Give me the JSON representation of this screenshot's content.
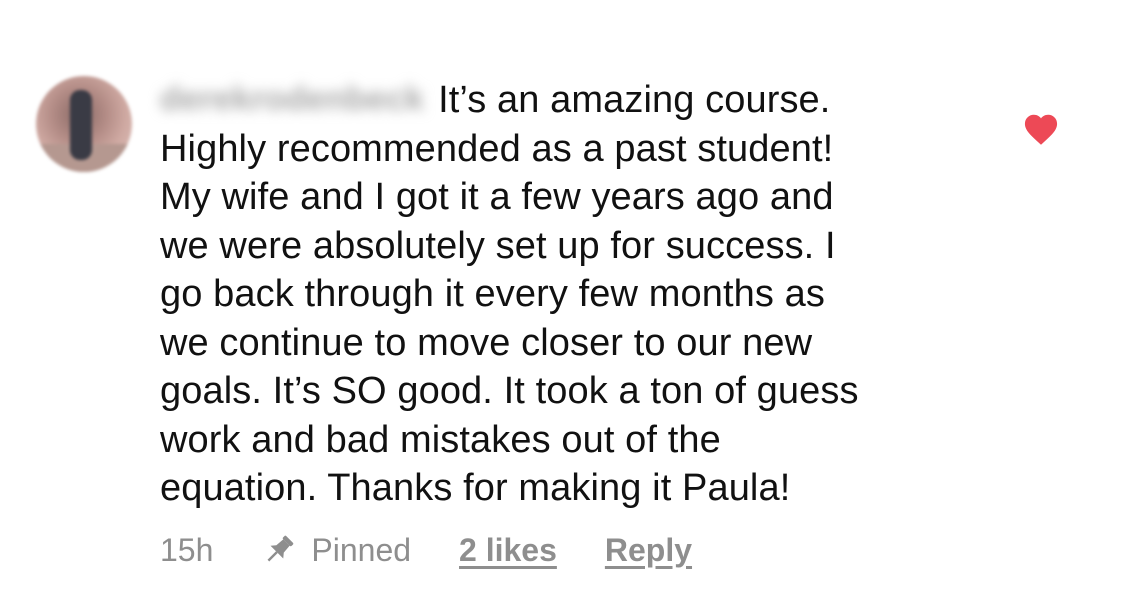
{
  "comment": {
    "username": "derekrodenbeck",
    "lines": [
      "It’s an amazing course.",
      "Highly recommended as a past student!",
      "My wife and I got it a few years ago and",
      "we were absolutely set up for success. I",
      "go back through it every few months as",
      "we continue to move closer to our new",
      "goals. It’s SO good. It took a ton of guess",
      "work and bad mistakes out of the",
      "equation. Thanks for making it Paula!"
    ],
    "liked": true
  },
  "meta": {
    "time": "15h",
    "pinned_label": "Pinned",
    "likes_label": "2 likes",
    "reply_label": "Reply"
  },
  "colors": {
    "heart": "#ed4956",
    "meta_text": "#8e8e8e",
    "body_text": "#111111"
  },
  "icons": {
    "heart": "heart-filled-icon",
    "pin": "pin-icon"
  }
}
